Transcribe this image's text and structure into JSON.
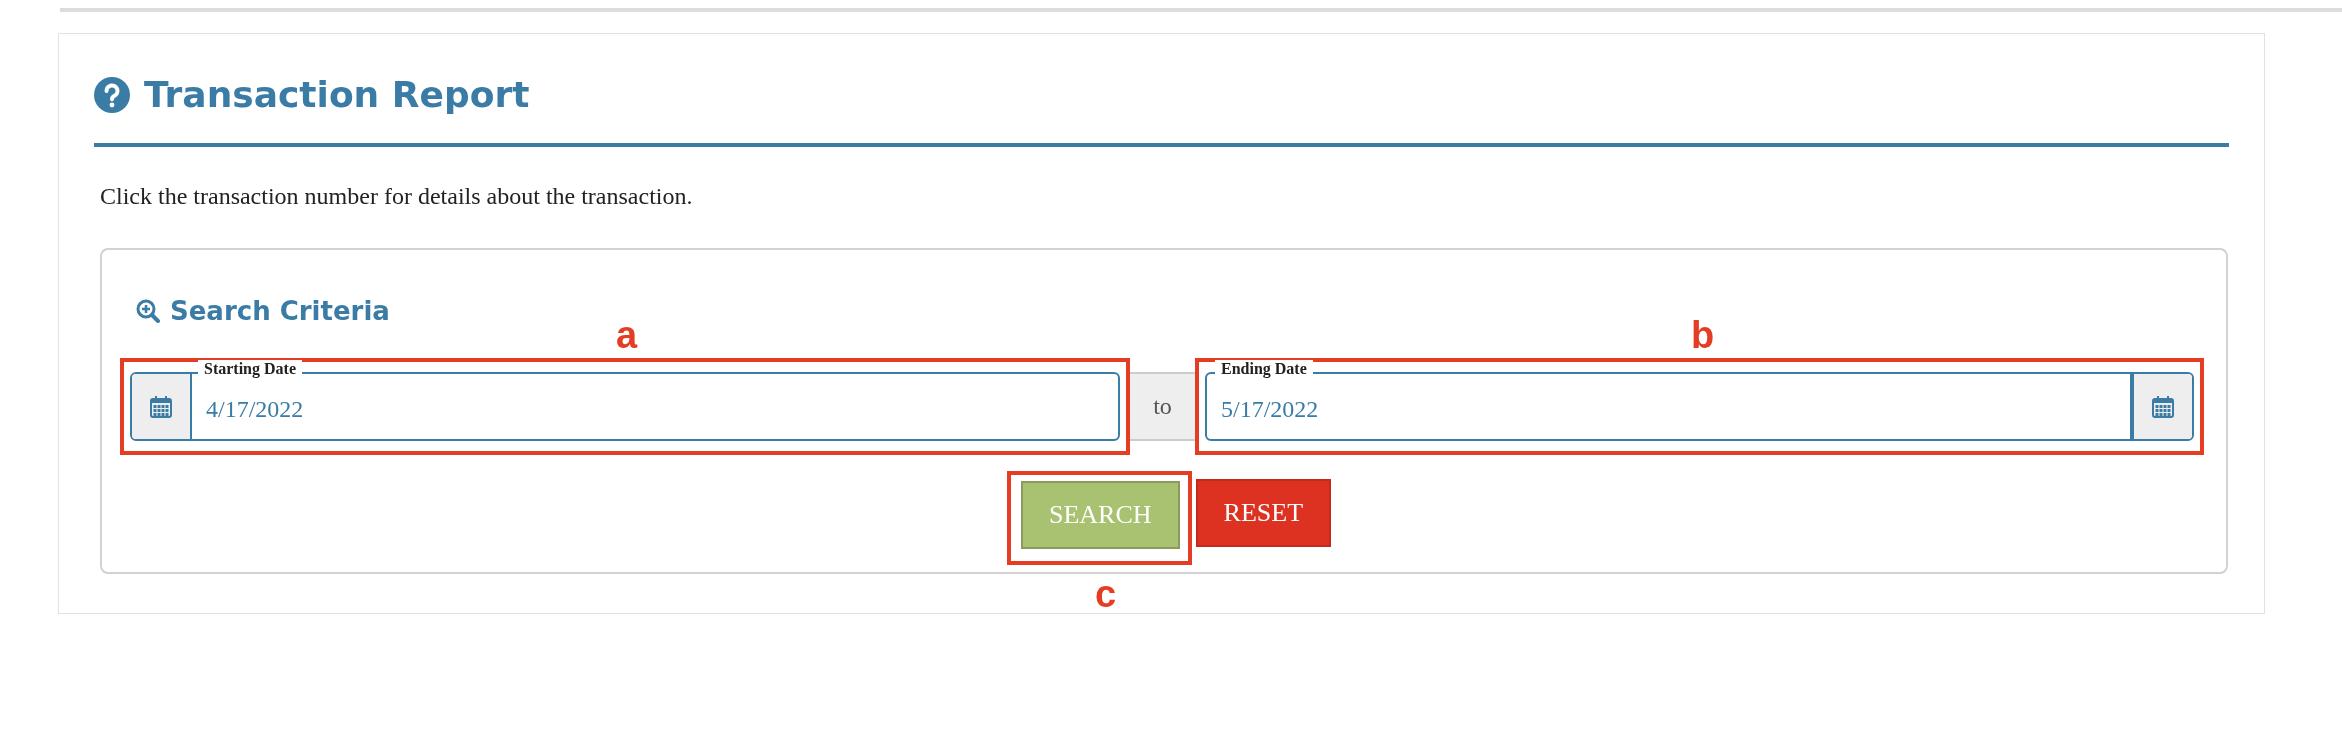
{
  "report": {
    "title": "Transaction Report",
    "description": "Click the transaction number for details about the transaction."
  },
  "search_criteria": {
    "title": "Search Criteria",
    "starting_date": {
      "label": "Starting Date",
      "value": "4/17/2022"
    },
    "separator": "to",
    "ending_date": {
      "label": "Ending Date",
      "value": "5/17/2022"
    }
  },
  "buttons": [
    {
      "label": "SEARCH",
      "kind": "primary"
    },
    {
      "label": "RESET",
      "kind": "danger"
    }
  ],
  "annotations": [
    {
      "label": "a"
    },
    {
      "label": "b"
    },
    {
      "label": "c"
    }
  ]
}
